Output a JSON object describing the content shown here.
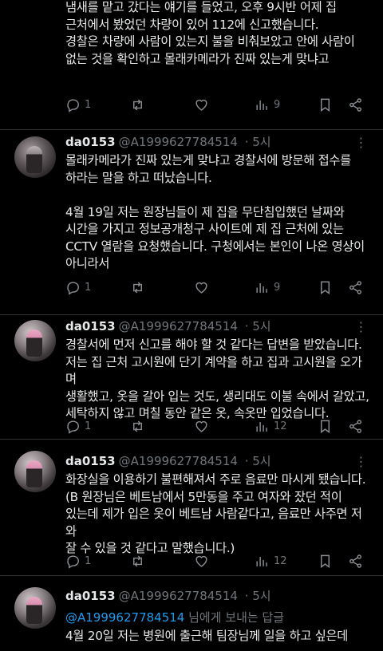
{
  "tweets": [
    {
      "body": "냄새를 맡고 갔다는 얘기를 들었고, 오후 9시반 어제 집\n근처에서 봤었던 차량이 있어 112에 신고했습니다.\n경찰은 차량에 사람이 있는지 불을 비춰보았고 안에 사람이\n없는 것을 확인하고 몰래카메라가 진짜 있는게 맞냐고",
      "replies": "1",
      "views": "9"
    },
    {
      "name": "da0153",
      "handle": "@A1999627784514",
      "time": "· 5시",
      "body": "몰래카메라가 진짜 있는게 맞냐고 경찰서에 방문해 접수를\n하라는 말을 하고 떠났습니다.\n\n4월 19일 저는 원장님들이 제 집을 무단침입했던 날짜와\n시간을 가지고 정보공개청구 사이트에 제 집 근처에 있는\nCCTV 열람을 요청했습니다. 구청에서는 본인이 나온 영상이\n아니라서",
      "replies": "1",
      "views": "9"
    },
    {
      "name": "da0153",
      "handle": "@A1999627784514",
      "time": "· 5시",
      "body": "경찰서에 먼저 신고를 해야 할 것 같다는 답변을 받았습니다.\n저는 집 근처 고시원에 단기 계약을 하고 집과 고시원을 오가며\n생활했고, 옷을 갈아 입는 것도, 생리대도 이불 속에서 갈았고,\n세탁하지 않고 며칠 동안 같은 옷, 속옷만 입었습니다.",
      "replies": "1",
      "views": "12"
    },
    {
      "name": "da0153",
      "handle": "@A1999627784514",
      "time": "· 5시",
      "body": "화장실을 이용하기 불편해져서 주로 음료만 마시게 됐습니다.\n(B 원장님은 베트남에서 5만동을 주고 여자와 잤던 적이\n있는데 제가 입은 옷이 베트남 사람같다고, 음료만 사주면 저와\n잘 수 있을 것 같다고 말했습니다.)",
      "replies": "1",
      "views": "12"
    },
    {
      "name": "da0153",
      "handle": "@A1999627784514",
      "time": "· 5시",
      "reply_mention": "@A1999627784514",
      "reply_suffix": " 님에게 보내는 답글",
      "body": "4월 20일 저는 병원에 출근해 팀장님께 일을 하고 싶은데"
    }
  ],
  "icons": {
    "reply": "reply-icon",
    "retweet": "retweet-icon",
    "like": "heart-icon",
    "views": "views-icon",
    "bookmark": "bookmark-icon",
    "share": "share-icon",
    "more": "more-icon"
  },
  "colors": {
    "background": "#000000",
    "text": "#e7e9ea",
    "muted": "#71767b",
    "link": "#1d9bf0",
    "divider": "#2f3336"
  }
}
